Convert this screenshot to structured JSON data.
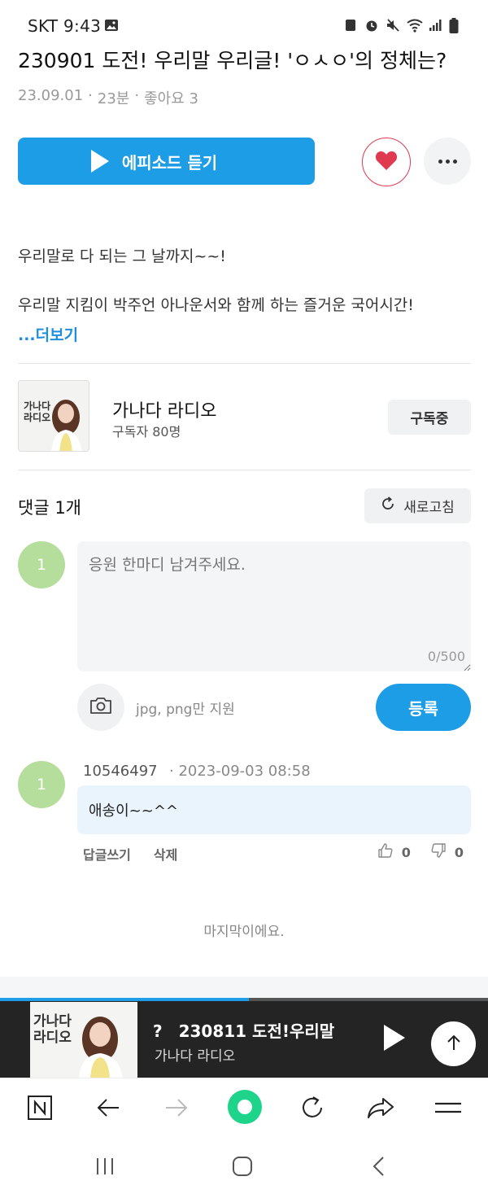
{
  "status_bar": {
    "carrier_time": "SKT 9:43"
  },
  "episode": {
    "title": "230901 도전! 우리말 우리글! 'ㅇㅅㅇ'의 정체는?",
    "meta": [
      "23.09.01",
      "·",
      "23분",
      "·",
      "좋아요 3"
    ],
    "play_label": "에피소드 듣기"
  },
  "description": {
    "line1": "우리말로 다 되는 그 날까지~~!",
    "line2": "우리말 지킴이 박주언 아나운서와 함께 하는 즐거운 국어시간!",
    "more_label": "...더보기"
  },
  "channel": {
    "thumb_text": "가나다 라디오",
    "name": "가나다 라디오",
    "subscribers": "구독자 80명",
    "subscribe_label": "구독중"
  },
  "comments": {
    "header": "댓글 1개",
    "refresh_label": "새로고침",
    "my_avatar": "1",
    "placeholder": "응원 한마디 남겨주세요.",
    "counter": "0/500",
    "attach_hint": "jpg, png만 지원",
    "submit_label": "등록",
    "items": [
      {
        "avatar": "1",
        "user": "10546497",
        "date": "· 2023-09-03 08:58",
        "text": "애송이~~^^",
        "reply_label": "답글쓰기",
        "delete_label": "삭제",
        "likes": "0",
        "dislikes": "0"
      }
    ],
    "end_text": "마지막이에요."
  },
  "player": {
    "progress_percent": 51,
    "title": "?　230811 도전!우리말",
    "channel": "가나다 라디오"
  },
  "colors": {
    "accent": "#1e9de7",
    "like": "#e03a50",
    "avatar": "#b5dd9b"
  }
}
